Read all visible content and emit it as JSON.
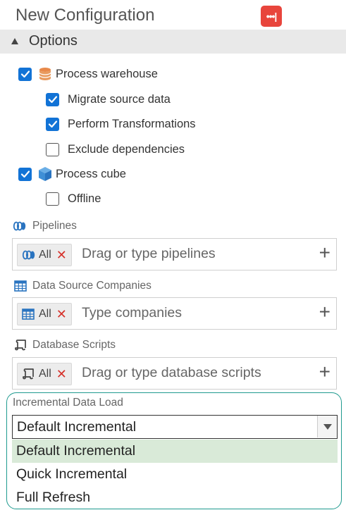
{
  "window": {
    "title": "New Configuration",
    "menu_button_label": "•••|"
  },
  "options_section": {
    "title": "Options",
    "checkboxes": [
      {
        "label": "Process warehouse",
        "checked": true
      },
      {
        "label": "Migrate source data",
        "checked": true
      },
      {
        "label": "Perform Transformations",
        "checked": true
      },
      {
        "label": "Exclude dependencies",
        "checked": false
      },
      {
        "label": "Process cube",
        "checked": true
      },
      {
        "label": "Offline",
        "checked": false
      }
    ]
  },
  "pipelines": {
    "label": "Pipelines",
    "tag_label": "All",
    "tag_remove": "✕",
    "placeholder": "Drag or type pipelines",
    "add_symbol": "+"
  },
  "data_source_companies": {
    "label": "Data Source Companies",
    "tag_label": "All",
    "tag_remove": "✕",
    "placeholder": "Type companies",
    "add_symbol": "+"
  },
  "database_scripts": {
    "label": "Database Scripts",
    "tag_label": "All",
    "tag_remove": "✕",
    "placeholder": "Drag or type database scripts",
    "add_symbol": "+"
  },
  "incremental_data_load": {
    "label": "Incremental Data Load",
    "selected_value": "Default Incremental",
    "options": [
      "Default Incremental",
      "Quick Incremental",
      "Full Refresh"
    ],
    "highlighted_option": "Default Incremental"
  },
  "colors": {
    "accent_blue": "#1273d6",
    "title_button_red": "#e8453c",
    "remove_red": "#d6322b",
    "panel_border_teal": "#1f9a8f",
    "option_highlight": "#d9ead8",
    "section_header_bg": "#e9e9e9"
  },
  "icons": {
    "warehouse": "database-icon",
    "cube": "cube-icon",
    "pipelines": "pipelines-icon",
    "companies": "table-grid-icon",
    "scripts": "script-icon"
  }
}
